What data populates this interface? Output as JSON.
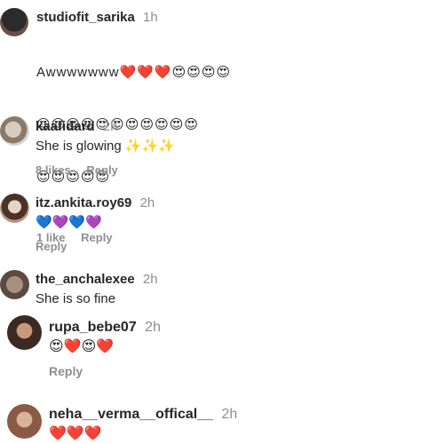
{
  "comments": [
    {
      "username": "studiofit_sarika",
      "time": "1h",
      "text": "Awwwwwww❤️❤️❤️😍😍😍😍",
      "text_line2": "😍😍😍😍😍😍😍😍😍😍😍",
      "text_line3": "😍😍😍😍😍",
      "likes": "1 like",
      "reply": "Reply"
    },
    {
      "username": "kaafidard",
      "time": "2h",
      "text": "She is glowing ✨✨✨",
      "likes": "8 likes",
      "reply": "Reply"
    },
    {
      "username": "itz.ankita.roy69",
      "time": "2h",
      "text": "💙💜💙💜",
      "reply": "Reply"
    },
    {
      "username": "the_anchalexee",
      "time": "2h",
      "text": "She is so fine"
    },
    {
      "username": "rupa_bebe07",
      "time": "2h",
      "text": "😍❤️😍❤️",
      "reply": "Reply"
    },
    {
      "username": "neha__verma__offical__",
      "time": "2h",
      "text": "❤️❤️❤️"
    }
  ]
}
